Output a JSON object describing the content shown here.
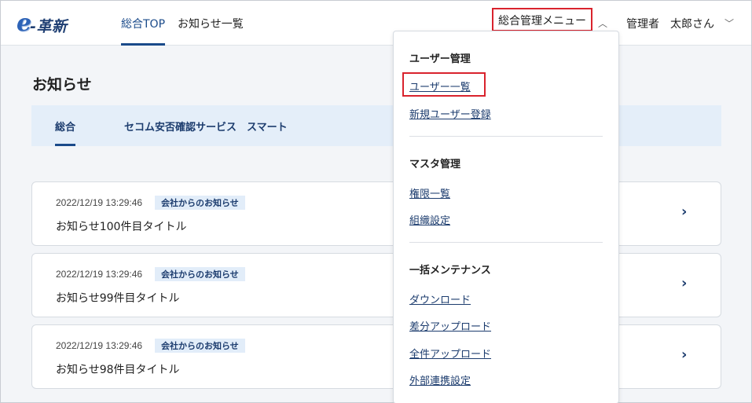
{
  "header": {
    "logo_e": "e",
    "logo_text": "-革新",
    "nav": [
      {
        "label": "総合TOP"
      },
      {
        "label": "お知らせ一覧"
      }
    ],
    "admin_menu_label": "総合管理メニュー",
    "admin_menu_chevron": "^",
    "user_role": "管理者",
    "user_name": "太郎さん",
    "user_chevron": "v"
  },
  "page": {
    "title": "お知らせ",
    "tabs": [
      {
        "label": "総合"
      },
      {
        "label": "セコム安否確認サービス　スマート"
      }
    ]
  },
  "notices": [
    {
      "date": "2022/12/19 13:29:46",
      "badge": "会社からのお知らせ",
      "title": "お知らせ100件目タイトル"
    },
    {
      "date": "2022/12/19 13:29:46",
      "badge": "会社からのお知らせ",
      "title": "お知らせ99件目タイトル"
    },
    {
      "date": "2022/12/19 13:29:46",
      "badge": "会社からのお知らせ",
      "title": "お知らせ98件目タイトル"
    }
  ],
  "dropdown": {
    "sections": [
      {
        "heading": "ユーザー管理",
        "items": [
          {
            "label": "ユーザー一覧"
          },
          {
            "label": "新規ユーザー登録"
          }
        ]
      },
      {
        "heading": "マスタ管理",
        "items": [
          {
            "label": "権限一覧"
          },
          {
            "label": "組織設定"
          }
        ]
      },
      {
        "heading": "一括メンテナンス",
        "items": [
          {
            "label": "ダウンロード"
          },
          {
            "label": "差分アップロード"
          },
          {
            "label": "全件アップロード"
          },
          {
            "label": "外部連携設定"
          }
        ]
      }
    ]
  },
  "colors": {
    "accent": "#1a4a8a",
    "highlight": "#d9232d",
    "tab_bg": "#e4eef9"
  },
  "icons": {
    "card_arrow": "chevron-right-icon"
  }
}
